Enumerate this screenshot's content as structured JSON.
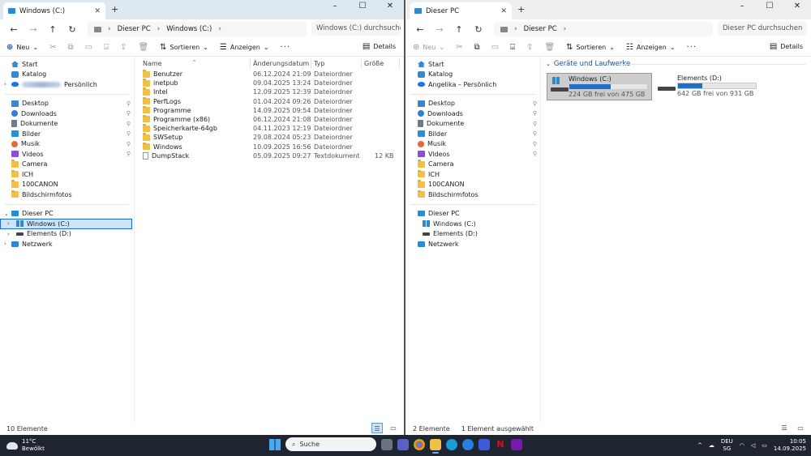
{
  "left_window": {
    "tab_title": "Windows (C:)",
    "breadcrumb": [
      "Dieser PC",
      "Windows (C:)"
    ],
    "search_placeholder": "Windows (C:) durchsuchen",
    "commands": {
      "new": "Neu",
      "sort": "Sortieren",
      "view": "Anzeigen",
      "more": "···",
      "details": "Details"
    },
    "nav": {
      "start": "Start",
      "catalog": "Katalog",
      "personal_suffix": "Persönlich",
      "quick": [
        "Desktop",
        "Downloads",
        "Dokumente",
        "Bilder",
        "Musik",
        "Videos",
        "Camera",
        "ICH",
        "100CANON",
        "Bildschirmfotos"
      ],
      "this_pc": "Dieser PC",
      "drive_c": "Windows (C:)",
      "drive_d": "Elements (D:)",
      "network": "Netzwerk"
    },
    "columns": {
      "name": "Name",
      "date": "Änderungsdatum",
      "type": "Typ",
      "size": "Größe"
    },
    "files": [
      {
        "name": "Benutzer",
        "date": "06.12.2024 21:09",
        "type": "Dateiordner",
        "size": ""
      },
      {
        "name": "inetpub",
        "date": "09.04.2025 13:24",
        "type": "Dateiordner",
        "size": ""
      },
      {
        "name": "Intel",
        "date": "12.09.2025 12:39",
        "type": "Dateiordner",
        "size": ""
      },
      {
        "name": "PerfLogs",
        "date": "01.04.2024 09:26",
        "type": "Dateiordner",
        "size": ""
      },
      {
        "name": "Programme",
        "date": "14.09.2025 09:54",
        "type": "Dateiordner",
        "size": ""
      },
      {
        "name": "Programme (x86)",
        "date": "06.12.2024 21:08",
        "type": "Dateiordner",
        "size": ""
      },
      {
        "name": "Speicherkarte-64gb",
        "date": "04.11.2023 12:19",
        "type": "Dateiordner",
        "size": ""
      },
      {
        "name": "SWSetup",
        "date": "29.08.2024 05:23",
        "type": "Dateiordner",
        "size": ""
      },
      {
        "name": "Windows",
        "date": "10.09.2025 16:56",
        "type": "Dateiordner",
        "size": ""
      },
      {
        "name": "DumpStack",
        "date": "05.09.2025 09:27",
        "type": "Textdokument",
        "size": "12 KB"
      }
    ],
    "status": "10 Elemente"
  },
  "right_window": {
    "tab_title": "Dieser PC",
    "breadcrumb": [
      "Dieser PC"
    ],
    "search_placeholder": "Dieser PC durchsuchen",
    "commands": {
      "new": "Neu",
      "sort": "Sortieren",
      "view": "Anzeigen",
      "more": "···",
      "details": "Details"
    },
    "nav": {
      "start": "Start",
      "catalog": "Katalog",
      "personal": "Angelika – Persönlich",
      "quick": [
        "Desktop",
        "Downloads",
        "Dokumente",
        "Bilder",
        "Musik",
        "Videos",
        "Camera",
        "ICH",
        "100CANON",
        "Bildschirmfotos"
      ],
      "this_pc": "Dieser PC",
      "drive_c": "Windows (C:)",
      "drive_d": "Elements (D:)",
      "network": "Netzwerk"
    },
    "group_title": "Geräte und Laufwerke",
    "drives": [
      {
        "name": "Windows (C:)",
        "free": "224 GB frei von 475 GB",
        "used_fraction": 0.53
      },
      {
        "name": "Elements (D:)",
        "free": "642 GB frei von 931 GB",
        "used_fraction": 0.31
      }
    ],
    "status_count": "2 Elemente",
    "status_selected": "1 Element ausgewählt"
  },
  "taskbar": {
    "temperature": "11°C",
    "weather": "Bewölkt",
    "search": "Suche",
    "lang": "DEU",
    "lang_sub": "SG",
    "time": "10:05",
    "date": "14.09.2025"
  },
  "colors": {
    "accent": "#1f6fc9",
    "folder": "#f1c048",
    "taskbar": "#1f2530"
  }
}
